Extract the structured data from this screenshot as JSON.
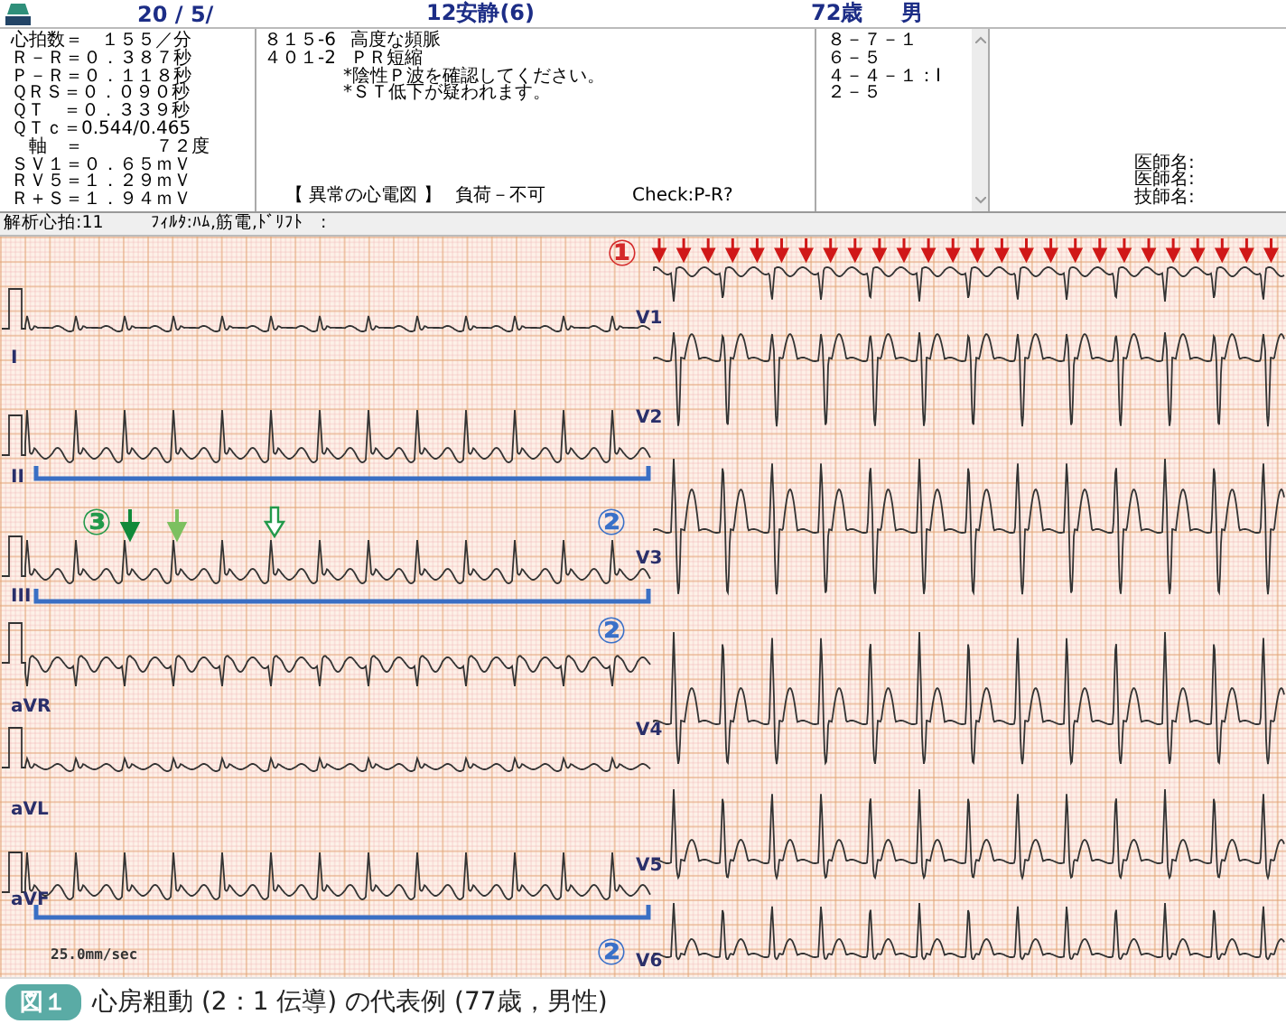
{
  "header": {
    "date": "20 / 5/",
    "recording": "12安静(6)",
    "age": "72歳",
    "sex": "男"
  },
  "measurements": [
    "心拍数＝　１５５／分",
    "Ｒ－Ｒ＝０．３８７秒",
    "Ｐ－Ｒ＝０．１１８秒",
    "ＱＲＳ＝０．０９０秒",
    "ＱＴ　＝０．３３９秒",
    "ＱＴｃ＝0.544/0.465",
    "　軸　＝　　　　７２度",
    "ＳＶ１＝０．６５ｍＶ",
    "ＲＶ５＝１．２９ｍＶ",
    "Ｒ＋Ｓ＝１．９４ｍＶ"
  ],
  "findings": [
    {
      "code": "８１５-6",
      "text": "高度な頻脈"
    },
    {
      "code": "４０１-2",
      "text": "ＰＲ短縮"
    }
  ],
  "comments": [
    "*陰性Ｐ波を確認してください。",
    "*ＳＴ低下が疑われます。"
  ],
  "classification": "【 異常の心電図 】",
  "load": "負荷－不可",
  "check": "Check:P-R?",
  "codes": [
    "８－７－１",
    "６－５",
    "４－４－１：Ⅰ",
    "２－５"
  ],
  "signatures": [
    "医師名:",
    "医師名:",
    "技師名:"
  ],
  "status": {
    "beats": "解析心拍:11",
    "filter": "ﾌｨﾙﾀ:ﾊﾑ,筋電,ﾄﾞﾘﾌﾄ　:"
  },
  "ecg": {
    "limb_leads": [
      "I",
      "II",
      "III",
      "aVR",
      "aVL",
      "aVF"
    ],
    "chest_leads": [
      "V1",
      "V2",
      "V3",
      "V4",
      "V5",
      "V6"
    ],
    "speed": "25.0mm/sec",
    "markers": [
      {
        "text": "①",
        "color": "#d42a2a"
      },
      {
        "text": "③",
        "color": "#22994a"
      },
      {
        "text": "②",
        "color": "#3a70c8"
      },
      {
        "text": "②",
        "color": "#3a70c8"
      },
      {
        "text": "②",
        "color": "#3a70c8"
      }
    ]
  },
  "caption": {
    "figure": "図１",
    "text": "心房粗動 (2：1 伝導) の代表例 (77歳，男性)"
  }
}
